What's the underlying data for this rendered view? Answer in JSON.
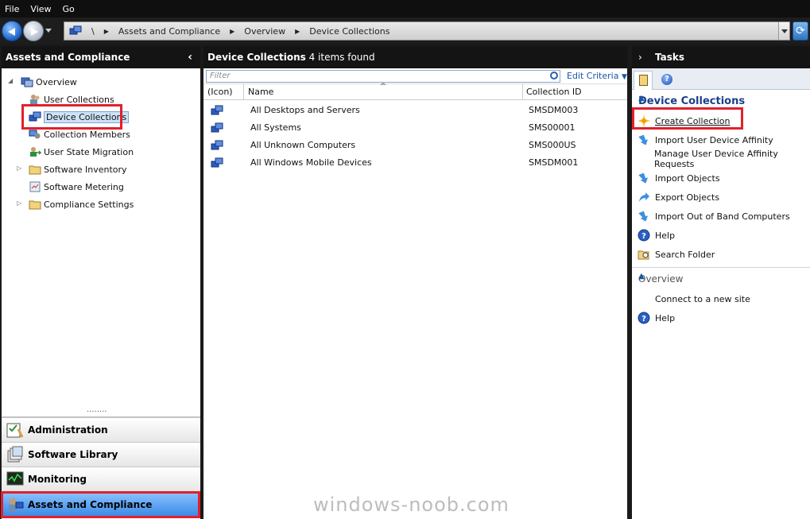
{
  "menu": [
    "File",
    "View",
    "Go"
  ],
  "address": {
    "root_sep": "\\",
    "crumbs": [
      "Assets and Compliance",
      "Overview",
      "Device Collections"
    ]
  },
  "left_panel": {
    "title": "Assets and Compliance",
    "tree": {
      "overview": "Overview",
      "user_collections": "User Collections",
      "device_collections": "Device Collections",
      "collection_members": "Collection Members",
      "user_state_migration": "User State Migration",
      "software_inventory": "Software Inventory",
      "software_metering": "Software Metering",
      "compliance_settings": "Compliance Settings"
    },
    "workspaces": {
      "administration": "Administration",
      "software_library": "Software Library",
      "monitoring": "Monitoring",
      "assets_and_compliance": "Assets and Compliance"
    }
  },
  "main": {
    "title": "Device Collections",
    "count": "4 items found",
    "filter_placeholder": "Filter",
    "edit_criteria": "Edit Criteria",
    "columns": {
      "icon": "(Icon)",
      "name": "Name",
      "collection_id": "Collection ID"
    },
    "rows": [
      {
        "name": "All Desktops and Servers",
        "id": "SMSDM003"
      },
      {
        "name": "All Systems",
        "id": "SMS00001"
      },
      {
        "name": "All Unknown Computers",
        "id": "SMS000US"
      },
      {
        "name": "All Windows Mobile Devices",
        "id": "SMSDM001"
      }
    ],
    "watermark": "windows-noob.com"
  },
  "tasks": {
    "title": "Tasks",
    "section1": {
      "title": "Device Collections",
      "items": {
        "create_collection": "Create Collection",
        "import_uda": "Import User Device Affinity",
        "manage_uda": "Manage User Device Affinity Requests",
        "import_objects": "Import Objects",
        "export_objects": "Export Objects",
        "import_oob": "Import Out of Band Computers",
        "help": "Help",
        "search_folder": "Search Folder"
      }
    },
    "section2": {
      "title": "Overview",
      "items": {
        "connect_site": "Connect to a new site",
        "help": "Help"
      }
    }
  },
  "colors": {
    "highlight": "#e2202b",
    "link": "#1a56a8",
    "active_workspace": "#3a8ae6"
  }
}
